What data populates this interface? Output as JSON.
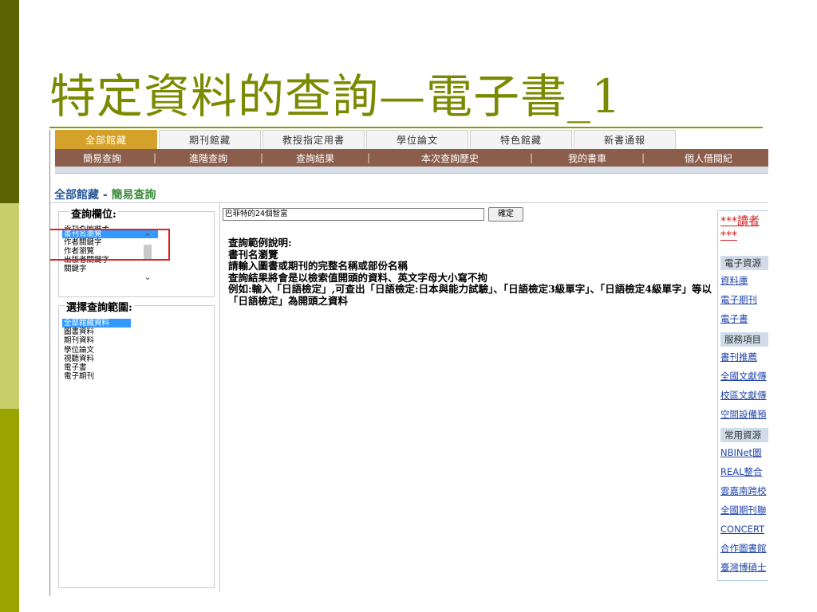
{
  "slide": {
    "title": "特定資料的查詢—電子書_1"
  },
  "tabs": [
    {
      "label": "全部館藏",
      "active": true
    },
    {
      "label": "期刊館藏",
      "active": false
    },
    {
      "label": "教授指定用書",
      "active": false
    },
    {
      "label": "學位論文",
      "active": false
    },
    {
      "label": "特色館藏",
      "active": false
    },
    {
      "label": "新書通報",
      "active": false
    }
  ],
  "subnav": [
    {
      "label": "簡易查詢"
    },
    {
      "label": "進階查詢"
    },
    {
      "label": "查詢結果"
    },
    {
      "label": "本次查詢歷史"
    },
    {
      "label": "我的書車"
    },
    {
      "label": "個人借閱紀"
    }
  ],
  "heading": {
    "part1": "全部館藏",
    "separator": " - ",
    "part2": "簡易查詢"
  },
  "left": {
    "field_label": "查詢欄位:",
    "field_options": [
      {
        "label": "書刊名關鍵字",
        "selected": false
      },
      {
        "label": "書刊名瀏覽",
        "selected": true
      },
      {
        "label": "作者關鍵字",
        "selected": false
      },
      {
        "label": "作者瀏覽",
        "selected": false
      },
      {
        "label": "出版者關鍵字",
        "selected": false
      },
      {
        "label": "關鍵字",
        "selected": false
      }
    ],
    "range_label": "選擇查詢範圍:",
    "range_options": [
      {
        "label": "全部館藏資料",
        "selected": true
      },
      {
        "label": "圖書資料",
        "selected": false
      },
      {
        "label": "期刊資料",
        "selected": false
      },
      {
        "label": "學位論文",
        "selected": false
      },
      {
        "label": "視聽資料",
        "selected": false
      },
      {
        "label": "電子書",
        "selected": false
      },
      {
        "label": "電子期刊",
        "selected": false
      }
    ]
  },
  "search": {
    "value": "巴菲特的24個智富",
    "button": "確定"
  },
  "help": {
    "title": "查詢範例說明:",
    "line1": "書刊名瀏覽",
    "line2": "請輸入圖書或期刊的完整名稱或部份名稱",
    "line3": "查詢結果將會是以檢索值開頭的資料、英文字母大小寫不拘",
    "line4": "例如:輸入「日語檢定」,可查出「日語檢定:日本與能力試驗」、「日語檢定3級單字」、「日語檢定4級單字」等以「日語檢定」為開頭之資料"
  },
  "right": {
    "notice_line1": "***讀者",
    "notice_line2": "***",
    "sections": [
      {
        "title": "電子資源",
        "links": [
          "資料庫",
          "電子期刊",
          "電子書"
        ]
      },
      {
        "title": "服務項目",
        "links": [
          "書刊推薦",
          "全國文獻傳",
          "校區文獻傳",
          "空間設備預"
        ]
      },
      {
        "title": "常用資源",
        "links": [
          "NBINet圖",
          "REAL整合",
          "雲嘉南跨校",
          "全國期刊聯",
          "CONCERT",
          "合作圖書館",
          "臺灣博碩士"
        ]
      }
    ]
  },
  "colors": {
    "title": "#7a8a00",
    "active_tab": "#d4a22a",
    "subnav": "#8b5e4c",
    "selection": "#3399ff",
    "highlight_box": "#e02020"
  }
}
